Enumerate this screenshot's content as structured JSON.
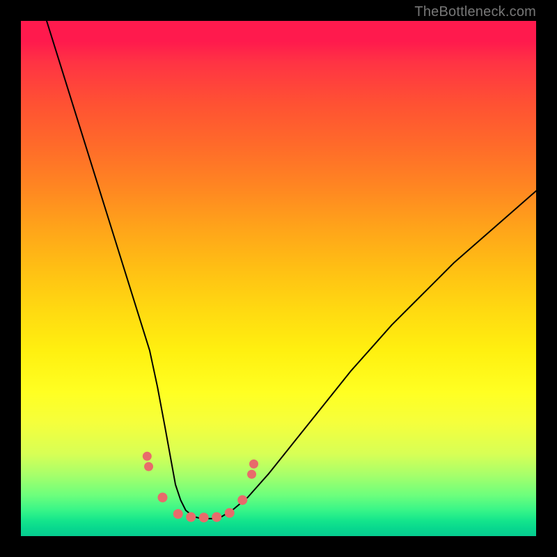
{
  "attribution": "TheBottleneck.com",
  "chart_data": {
    "type": "line",
    "title": "",
    "xlabel": "",
    "ylabel": "",
    "xlim": [
      0,
      100
    ],
    "ylim": [
      0,
      100
    ],
    "background": "rainbow-gradient-vertical",
    "series": [
      {
        "name": "bottleneck-curve",
        "x": [
          5,
          7.5,
          10,
          12.5,
          15,
          17.5,
          20,
          22.5,
          25,
          26.5,
          28,
          29,
          30,
          31,
          32,
          33.5,
          35,
          37,
          39,
          41,
          44,
          48,
          52,
          56,
          60,
          64,
          68,
          72,
          76,
          80,
          84,
          88,
          92,
          96,
          100
        ],
        "values": [
          100,
          92,
          84,
          76,
          68,
          60,
          52,
          44,
          36,
          29,
          21,
          15.5,
          10,
          7,
          5,
          3.8,
          3.4,
          3.4,
          3.8,
          5,
          7.5,
          12,
          17,
          22,
          27,
          32,
          36.5,
          41,
          45,
          49,
          53,
          56.5,
          60,
          63.5,
          67
        ],
        "stroke": "#000000",
        "stroke_width": 2
      }
    ],
    "markers": [
      {
        "name": "marker-left-upper-1",
        "x": 24.5,
        "y": 15.5,
        "r": 6.5,
        "fill": "#e86b6b"
      },
      {
        "name": "marker-left-upper-2",
        "x": 24.8,
        "y": 13.5,
        "r": 6.5,
        "fill": "#e86b6b"
      },
      {
        "name": "marker-left-lower",
        "x": 27.5,
        "y": 7.5,
        "r": 7,
        "fill": "#e86b6b"
      },
      {
        "name": "marker-bottom-1",
        "x": 30.5,
        "y": 4.3,
        "r": 7,
        "fill": "#e86b6b"
      },
      {
        "name": "marker-bottom-2",
        "x": 33,
        "y": 3.7,
        "r": 7,
        "fill": "#e86b6b"
      },
      {
        "name": "marker-bottom-3",
        "x": 35.5,
        "y": 3.6,
        "r": 7,
        "fill": "#e86b6b"
      },
      {
        "name": "marker-bottom-4",
        "x": 38,
        "y": 3.7,
        "r": 7,
        "fill": "#e86b6b"
      },
      {
        "name": "marker-bottom-5",
        "x": 40.5,
        "y": 4.5,
        "r": 7,
        "fill": "#e86b6b"
      },
      {
        "name": "marker-right-lower",
        "x": 43,
        "y": 7,
        "r": 7,
        "fill": "#e86b6b"
      },
      {
        "name": "marker-right-upper-1",
        "x": 44.8,
        "y": 12,
        "r": 6.5,
        "fill": "#e86b6b"
      },
      {
        "name": "marker-right-upper-2",
        "x": 45.2,
        "y": 14,
        "r": 6.5,
        "fill": "#e86b6b"
      }
    ]
  },
  "colors": {
    "black": "#000000",
    "marker": "#e86b6b",
    "attribution": "#777777"
  }
}
